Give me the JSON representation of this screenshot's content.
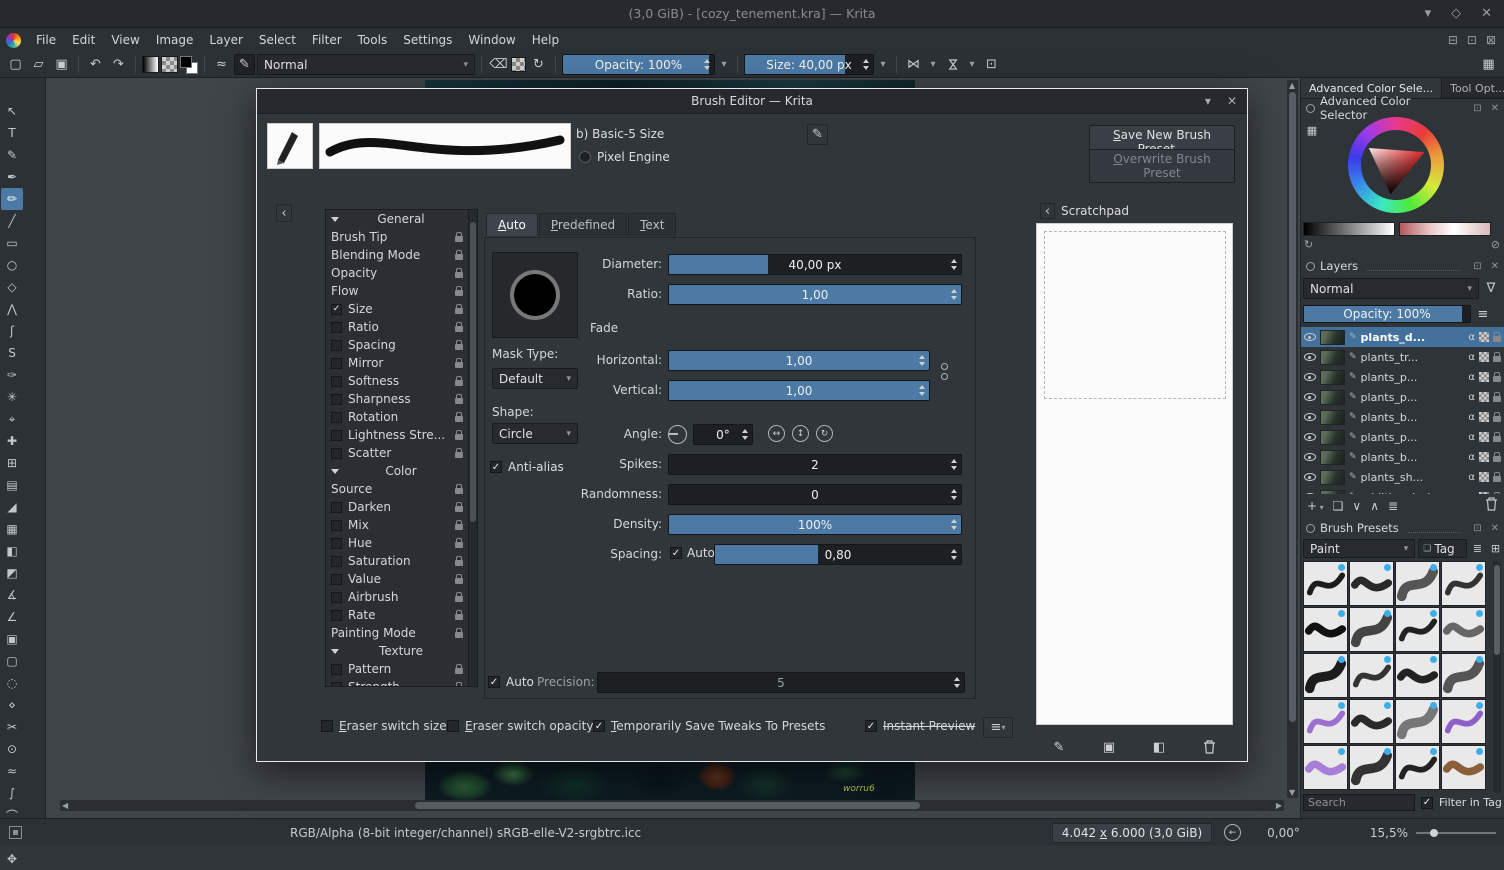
{
  "icons": {
    "minimize": "▾",
    "maximize": "◇",
    "close": "✕",
    "mdi_minimize": "⊟",
    "mdi_restore": "⊡",
    "mdi_close": "⊠",
    "collapse_left": "‹",
    "check": "✓",
    "dropdown": "▾",
    "new": "▢",
    "open": "▱",
    "save": "▣",
    "undo": "↶",
    "redo": "↷",
    "smoothing": "≈",
    "brush_editor": "✎",
    "eraser": "⌫",
    "reload": "↻",
    "mirror": "⋈",
    "trim": "⊡",
    "workspace": "▦",
    "edit": "✎",
    "menu": "≡",
    "grid": "⊞",
    "funnel": "∇",
    "add": "+",
    "duplicate": "❏",
    "arrow_down": "∨",
    "arrow_up": "∧",
    "properties": "≣",
    "refresh": "↻",
    "block": "⊘",
    "tag": "❏",
    "scratch_paint": "✎",
    "scratch_fill": "▣",
    "scratch_bucket": "◧",
    "scroll_up": "▲",
    "scroll_down": "▼",
    "scroll_left": "◀",
    "scroll_right": "▶",
    "rotate_reset": "←",
    "flip_h": "↔",
    "flip_v": "↕",
    "rotate": "↻"
  },
  "titlebar": {
    "title": "(3,0 GiB) - [cozy_tenement.kra] — Krita"
  },
  "menubar": {
    "items": [
      "File",
      "Edit",
      "View",
      "Image",
      "Layer",
      "Select",
      "Filter",
      "Tools",
      "Settings",
      "Window",
      "Help"
    ]
  },
  "toolbar": {
    "blend_mode": "Normal",
    "opacity_label": "Opacity: 100%",
    "opacity_fill": 97,
    "size_label": "Size: 40,00 px",
    "size_fill": 78
  },
  "toolbox": {
    "tools": [
      {
        "name": "select-shapes",
        "glyph": "↖"
      },
      {
        "name": "text",
        "glyph": "T"
      },
      {
        "name": "edit-shapes",
        "glyph": "✎"
      },
      {
        "name": "calligraphy",
        "glyph": "✒"
      },
      {
        "name": "freehand-brush",
        "glyph": "✏",
        "active": true
      },
      {
        "name": "line",
        "glyph": "╱"
      },
      {
        "name": "rectangle",
        "glyph": "▭"
      },
      {
        "name": "ellipse",
        "glyph": "○"
      },
      {
        "name": "polygon",
        "glyph": "◇"
      },
      {
        "name": "polyline",
        "glyph": "⋀"
      },
      {
        "name": "bezier-curve",
        "glyph": "ʃ"
      },
      {
        "name": "freehand-path",
        "glyph": "S"
      },
      {
        "name": "dynamic-brush",
        "glyph": "✑"
      },
      {
        "name": "multibrush",
        "glyph": "✳"
      },
      {
        "name": "transform",
        "glyph": "⌖"
      },
      {
        "name": "move",
        "glyph": "✚"
      },
      {
        "name": "crop",
        "glyph": "⊞"
      },
      {
        "name": "gradient",
        "glyph": "▤"
      },
      {
        "name": "color-sampler",
        "glyph": "◢"
      },
      {
        "name": "pattern-edit",
        "glyph": "▦"
      },
      {
        "name": "fill",
        "glyph": "◧"
      },
      {
        "name": "enclose-fill",
        "glyph": "◩"
      },
      {
        "name": "assistants",
        "glyph": "∡"
      },
      {
        "name": "measure",
        "glyph": "∠"
      },
      {
        "name": "reference-images",
        "glyph": "▣"
      },
      {
        "name": "rect-select",
        "glyph": "▢"
      },
      {
        "name": "ellipse-select",
        "glyph": "◌"
      },
      {
        "name": "polygon-select",
        "glyph": "⋄"
      },
      {
        "name": "freehand-select",
        "glyph": "✂"
      },
      {
        "name": "contiguous-select",
        "glyph": "⊙"
      },
      {
        "name": "similar-select",
        "glyph": "≈"
      },
      {
        "name": "bezier-select",
        "glyph": "∫"
      },
      {
        "name": "magnetic-select",
        "glyph": "⌒"
      },
      {
        "name": "zoom",
        "glyph": "◎"
      },
      {
        "name": "pan",
        "glyph": "✥"
      }
    ]
  },
  "canvas": {
    "signature": "worru6"
  },
  "dialog": {
    "title": "Brush Editor — Krita",
    "preset_name": "b) Basic-5 Size",
    "engine": "Pixel Engine",
    "save_button": "Save New Brush Preset...",
    "overwrite_button": "Overwrite Brush Preset",
    "tabs": [
      "Auto",
      "Predefined",
      "Text"
    ],
    "options": [
      {
        "label": "General",
        "type": "section"
      },
      {
        "label": "Brush Tip",
        "type": "plain"
      },
      {
        "label": "Blending Mode",
        "type": "plain"
      },
      {
        "label": "Opacity",
        "type": "plain"
      },
      {
        "label": "Flow",
        "type": "plain"
      },
      {
        "label": "Size",
        "type": "check",
        "checked": true
      },
      {
        "label": "Ratio",
        "type": "check",
        "checked": false
      },
      {
        "label": "Spacing",
        "type": "check",
        "checked": false
      },
      {
        "label": "Mirror",
        "type": "check",
        "checked": false
      },
      {
        "label": "Softness",
        "type": "check",
        "checked": false
      },
      {
        "label": "Sharpness",
        "type": "check",
        "checked": false
      },
      {
        "label": "Rotation",
        "type": "check",
        "checked": false
      },
      {
        "label": "Lightness Stre...",
        "type": "check",
        "checked": false
      },
      {
        "label": "Scatter",
        "type": "check",
        "checked": false
      },
      {
        "label": "Color",
        "type": "section"
      },
      {
        "label": "Source",
        "type": "plain"
      },
      {
        "label": "Darken",
        "type": "check",
        "checked": false
      },
      {
        "label": "Mix",
        "type": "check",
        "checked": false
      },
      {
        "label": "Hue",
        "type": "check",
        "checked": false
      },
      {
        "label": "Saturation",
        "type": "check",
        "checked": false
      },
      {
        "label": "Value",
        "type": "check",
        "checked": false
      },
      {
        "label": "Airbrush",
        "type": "check",
        "checked": false
      },
      {
        "label": "Rate",
        "type": "check",
        "checked": false
      },
      {
        "label": "Painting Mode",
        "type": "plain"
      },
      {
        "label": "Texture",
        "type": "section"
      },
      {
        "label": "Pattern",
        "type": "check",
        "checked": false
      },
      {
        "label": "Strength",
        "type": "check",
        "checked": false
      }
    ],
    "params": {
      "diameter": {
        "label": "Diameter:",
        "value": "40,00 px",
        "fill": 34
      },
      "ratio": {
        "label": "Ratio:",
        "value": "1,00",
        "fill": 100
      },
      "fade": "Fade",
      "mask_type_label": "Mask Type:",
      "mask_type": "Default",
      "horizontal": {
        "label": "Horizontal:",
        "value": "1,00",
        "fill": 100
      },
      "vertical": {
        "label": "Vertical:",
        "value": "1,00",
        "fill": 100
      },
      "shape_label": "Shape:",
      "shape": "Circle",
      "angle_label": "Angle:",
      "angle_value": "0°",
      "antialias": "Anti-alias",
      "spikes": {
        "label": "Spikes:",
        "value": "2",
        "fill": 0
      },
      "randomness": {
        "label": "Randomness:",
        "value": "0",
        "fill": 0
      },
      "density": {
        "label": "Density:",
        "value": "100%",
        "fill": 100
      },
      "spacing_label": "Spacing:",
      "spacing_auto": "Auto",
      "spacing": {
        "value": "0,80",
        "fill": 42
      },
      "auto_label": "Auto",
      "precision_label": "Precision:",
      "precision": {
        "value": "5",
        "fill": 0
      }
    },
    "footer": {
      "eraser_switch_size": "Eraser switch size",
      "eraser_switch_opacity": "Eraser switch opacity",
      "save_tweaks": "Temporarily Save Tweaks To Presets",
      "instant_preview": "Instant Preview"
    },
    "scratchpad": {
      "title": "Scratchpad"
    }
  },
  "right_panel": {
    "tabs": [
      "Advanced Color Sele...",
      "Tool Opt..."
    ],
    "color_selector": {
      "title": "Advanced Color Selector"
    },
    "layers": {
      "title": "Layers",
      "blend_mode": "Normal",
      "opacity_label": "Opacity:  100%",
      "opacity_fill": 95,
      "rows": [
        {
          "name": "plants_d...",
          "selected": true
        },
        {
          "name": "plants_tr...",
          "selected": false
        },
        {
          "name": "plants_p...",
          "selected": false
        },
        {
          "name": "plants_p...",
          "selected": false
        },
        {
          "name": "plants_b...",
          "selected": false
        },
        {
          "name": "plants_p...",
          "selected": false
        },
        {
          "name": "plants_b...",
          "selected": false
        },
        {
          "name": "plants_sh...",
          "selected": false
        },
        {
          "name": "additional_ob...",
          "selected": false
        }
      ]
    },
    "brush_presets": {
      "title": "Brush Presets",
      "filter": "Paint",
      "tag_label": "Tag",
      "search_placeholder": "Search",
      "filter_in_tag": "Filter in Tag",
      "cells": [
        {
          "stroke": "#1c1c1c"
        },
        {
          "stroke": "#2a2a2a"
        },
        {
          "stroke": "#555555"
        },
        {
          "stroke": "#333333"
        },
        {
          "stroke": "#111111"
        },
        {
          "stroke": "#444444"
        },
        {
          "stroke": "#222222"
        },
        {
          "stroke": "#666666"
        },
        {
          "stroke": "#1c1c1c"
        },
        {
          "stroke": "#333333"
        },
        {
          "stroke": "#222222"
        },
        {
          "stroke": "#555555"
        },
        {
          "stroke": "#9a6fd0"
        },
        {
          "stroke": "#2a2a2a"
        },
        {
          "stroke": "#777777"
        },
        {
          "stroke": "#8e5fc8"
        },
        {
          "stroke": "#a77fd8"
        },
        {
          "stroke": "#333333"
        },
        {
          "stroke": "#222222"
        },
        {
          "stroke": "#8a5f3a"
        }
      ]
    }
  },
  "statusbar": {
    "profile": "RGB/Alpha (8-bit integer/channel)  sRGB-elle-V2-srgbtrc.icc",
    "dims_a": "4.042",
    "dims_x": "x",
    "dims_b": "6.000 (3,0 GiB)",
    "angle": "0,00°",
    "zoom": "15,5%"
  }
}
